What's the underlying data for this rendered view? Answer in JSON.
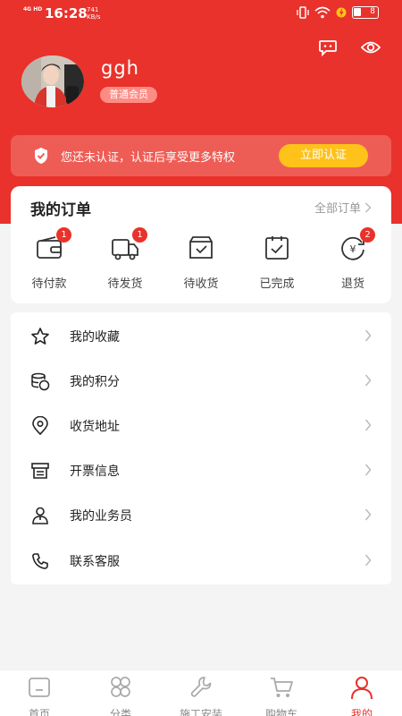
{
  "status_bar": {
    "network": "4G HD",
    "time": "16:28",
    "speed_value": "741",
    "speed_unit": "KB/s",
    "battery": "8"
  },
  "profile": {
    "username": "ggh",
    "member_level": "普通会员"
  },
  "verify": {
    "message": "您还未认证，认证后享受更多特权",
    "button": "立即认证"
  },
  "orders": {
    "title": "我的订单",
    "all_label": "全部订单",
    "items": [
      {
        "label": "待付款",
        "badge": "1",
        "icon": "wallet-icon"
      },
      {
        "label": "待发货",
        "badge": "1",
        "icon": "truck-icon"
      },
      {
        "label": "待收货",
        "badge": "",
        "icon": "box-icon"
      },
      {
        "label": "已完成",
        "badge": "",
        "icon": "clipboard-check-icon"
      },
      {
        "label": "退货",
        "badge": "2",
        "icon": "refund-icon"
      }
    ]
  },
  "menu": {
    "items": [
      {
        "label": "我的收藏",
        "icon": "star-icon"
      },
      {
        "label": "我的积分",
        "icon": "coins-icon"
      },
      {
        "label": "收货地址",
        "icon": "location-icon"
      },
      {
        "label": "开票信息",
        "icon": "invoice-icon"
      },
      {
        "label": "我的业务员",
        "icon": "person-icon"
      },
      {
        "label": "联系客服",
        "icon": "phone-icon"
      }
    ]
  },
  "tabbar": {
    "items": [
      {
        "label": "首页",
        "icon": "home-icon",
        "active": false
      },
      {
        "label": "分类",
        "icon": "grid-icon",
        "active": false
      },
      {
        "label": "施工安装",
        "icon": "wrench-icon",
        "active": false
      },
      {
        "label": "购物车",
        "icon": "cart-icon",
        "active": false
      },
      {
        "label": "我的",
        "icon": "user-icon",
        "active": true
      }
    ]
  },
  "colors": {
    "brand_red": "#e8322b",
    "verify_button": "#ffc21a",
    "badge_pink": "#ff8c84"
  }
}
